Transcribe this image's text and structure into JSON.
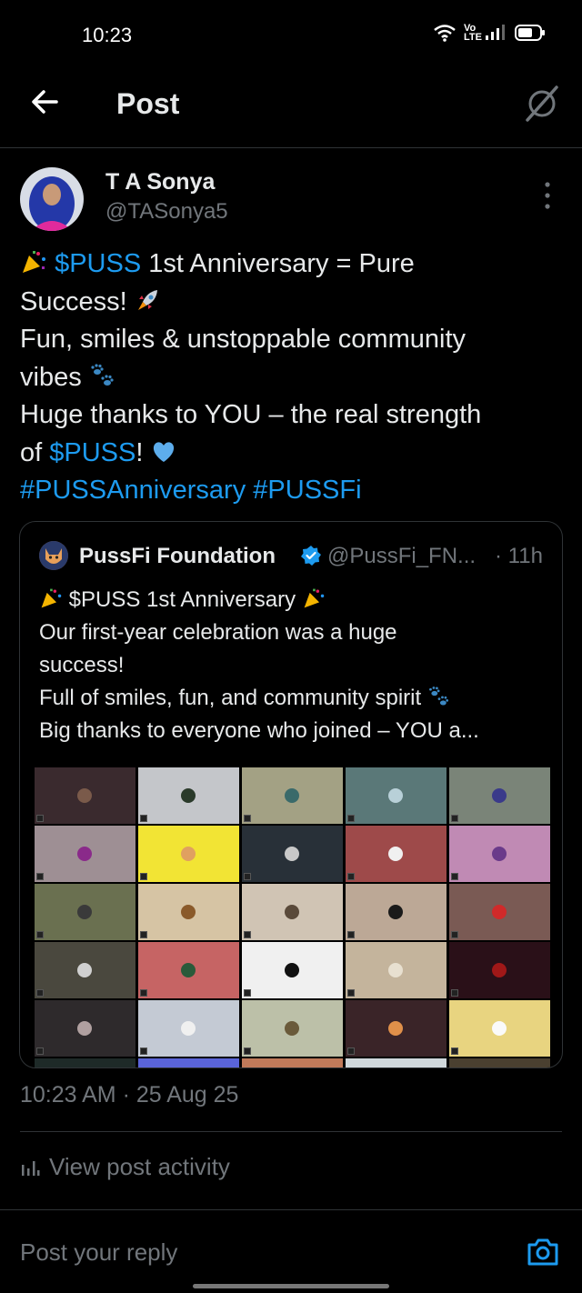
{
  "status_bar": {
    "time": "10:23",
    "network": "Vo LTE"
  },
  "header": {
    "title": "Post"
  },
  "author": {
    "name": "T A Sonya",
    "handle": "@TASonya5"
  },
  "tweet": {
    "l1_cashtag": "$PUSS",
    "l1_text": " 1st Anniversary = Pure",
    "l2_text": "Success! ",
    "l3_text": "Fun, smiles & unstoppable community",
    "l4_text": "vibes ",
    "l5_text": "Huge thanks to YOU – the real strength",
    "l6_pre": "of ",
    "l6_cashtag": "$PUSS",
    "l6_post": "! ",
    "hashtag_1": "#PUSSAnniversary",
    "hashtag_2": "#PUSSFi"
  },
  "quote": {
    "name": "PussFi Foundation",
    "handle": "@PussFi_FN...",
    "time": "· 11h",
    "l1_text": " $PUSS 1st Anniversary ",
    "l2_text": "Our first-year celebration was a huge",
    "l3_text": "success!",
    "l4_text": "Full of smiles, fun, and community spirit ",
    "l5_text": "Big thanks to everyone who joined – YOU a..."
  },
  "footer": {
    "timestamp": "10:23 AM · 25 Aug 25",
    "view_activity": "View post activity",
    "reply_placeholder": "Post your reply"
  },
  "colors": {
    "accent": "#1d9bf0",
    "background": "#000000",
    "secondary_text": "#71767b"
  },
  "icons": [
    "back-arrow-icon",
    "grok-icon",
    "more-vertical-icon",
    "verified-badge-icon",
    "bar-chart-icon",
    "camera-icon",
    "wifi-icon",
    "signal-icon",
    "battery-icon"
  ]
}
